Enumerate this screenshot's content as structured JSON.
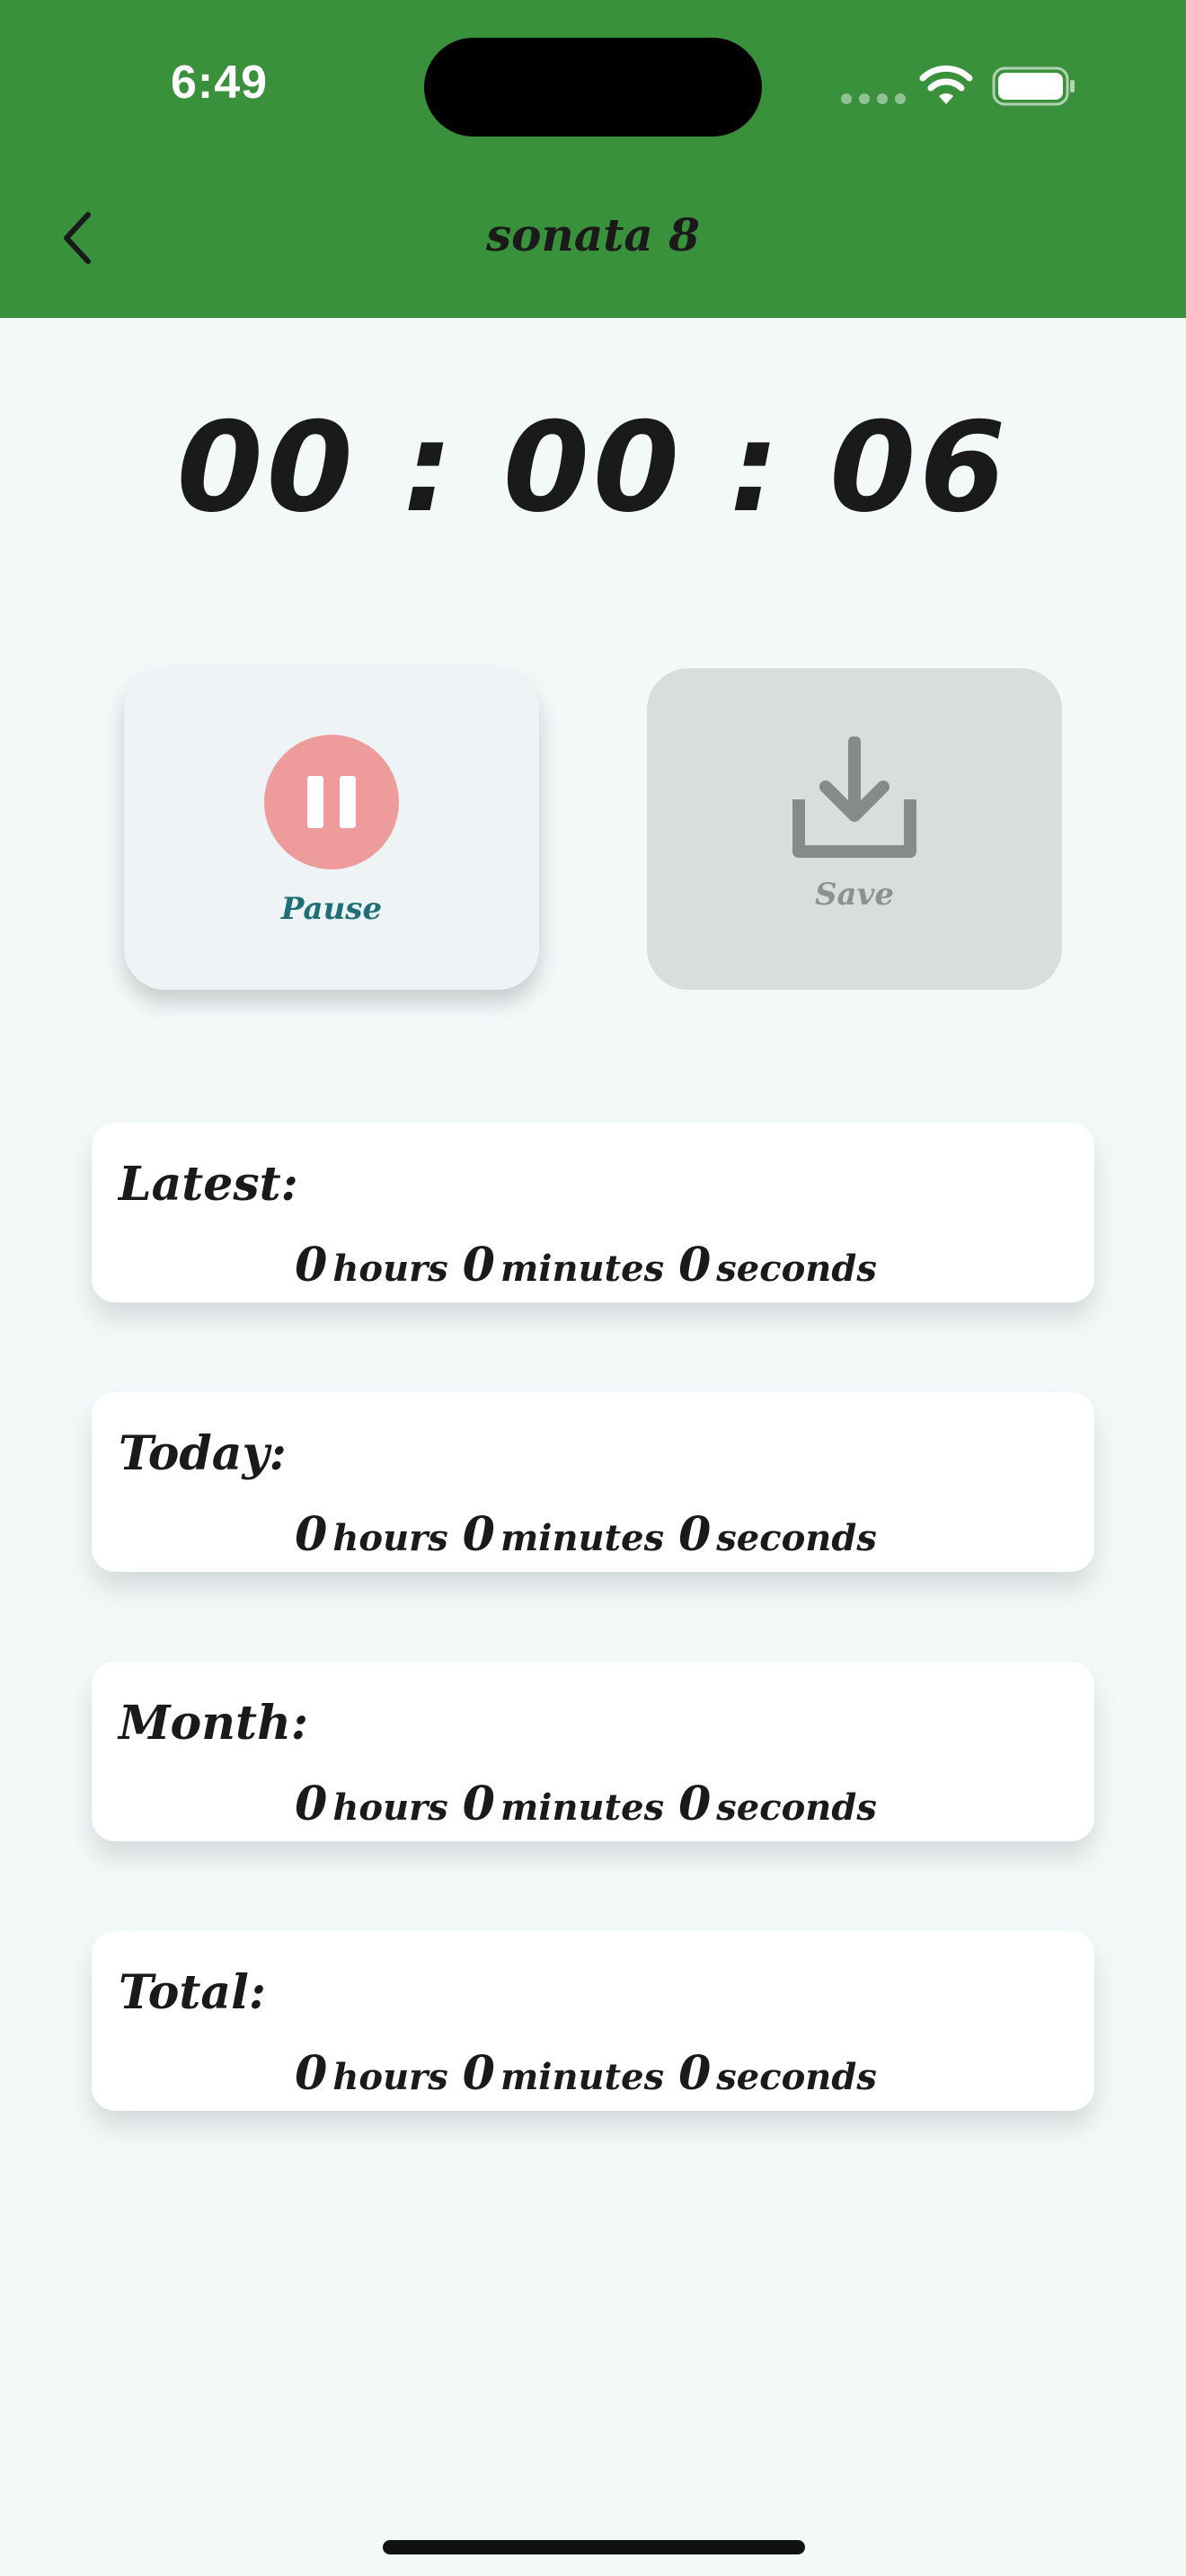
{
  "status_bar": {
    "time": "6:49",
    "icons": [
      "cellular-dots-icon",
      "wifi-icon",
      "battery-icon"
    ]
  },
  "nav": {
    "back_icon": "chevron-left-icon",
    "title": "sonata 8",
    "background": "#3a913c"
  },
  "timer": {
    "display": "00 : 00 : 06"
  },
  "actions": {
    "pause": {
      "label": "Pause",
      "icon": "pause-icon",
      "accent": "#ee9b9c"
    },
    "save": {
      "label": "Save",
      "icon": "download-icon",
      "disabled": true
    }
  },
  "stats": [
    {
      "label": "Latest:",
      "hours": "0",
      "hours_unit": "hours",
      "minutes": "0",
      "minutes_unit": "minutes",
      "seconds": "0",
      "seconds_unit": "seconds"
    },
    {
      "label": "Today:",
      "hours": "0",
      "hours_unit": "hours",
      "minutes": "0",
      "minutes_unit": "minutes",
      "seconds": "0",
      "seconds_unit": "seconds"
    },
    {
      "label": "Month:",
      "hours": "0",
      "hours_unit": "hours",
      "minutes": "0",
      "minutes_unit": "minutes",
      "seconds": "0",
      "seconds_unit": "seconds"
    },
    {
      "label": "Total:",
      "hours": "0",
      "hours_unit": "hours",
      "minutes": "0",
      "minutes_unit": "minutes",
      "seconds": "0",
      "seconds_unit": "seconds"
    }
  ]
}
